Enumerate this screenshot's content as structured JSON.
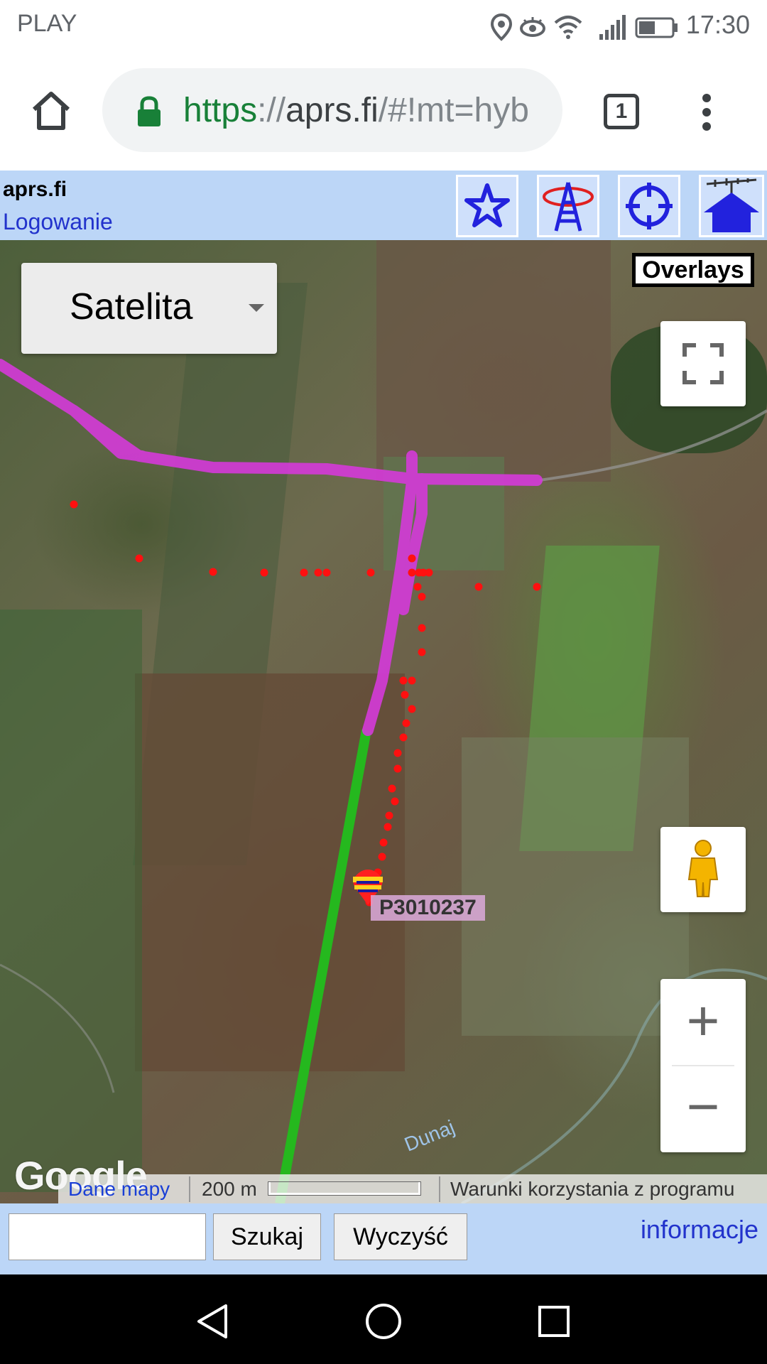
{
  "status_bar": {
    "carrier": "PLAY",
    "time": "17:30",
    "icons": [
      "location-icon",
      "eye-icon",
      "wifi-icon",
      "signal-icon",
      "battery-icon"
    ]
  },
  "browser": {
    "url_scheme": "https",
    "url_sep": "://",
    "url_host": "aprs.fi",
    "url_rest": "/#!mt=hyb",
    "tab_count": "1",
    "icons": [
      "home-icon",
      "lock-icon",
      "tabs-icon",
      "more-vert-icon"
    ]
  },
  "header": {
    "site_title": "aprs.fi",
    "login_label": "Logowanie",
    "buttons": [
      "favorites-star-icon",
      "antenna-tower-icon",
      "locate-crosshair-icon",
      "home-antenna-icon"
    ]
  },
  "map": {
    "map_type": "Satelita",
    "overlays_label": "Overlays",
    "zoom_in_label": "+",
    "zoom_out_label": "−",
    "station_label": "P3010237",
    "river_label": "Dunaj",
    "google_label": "Google",
    "map_data_label": "Dane mapy",
    "scale_label": "200 m",
    "terms_label": "Warunki korzystania z programu",
    "colors": {
      "track": "#d53ad9",
      "track_points": "#ff1010",
      "path_green": "#25b81e"
    }
  },
  "search_bar": {
    "input_value": "",
    "search_label": "Szukaj",
    "clear_label": "Wyczyść",
    "info_label": "informacje"
  },
  "nav_bar": {
    "icons": [
      "back-icon",
      "home-circle-icon",
      "recents-icon"
    ]
  }
}
